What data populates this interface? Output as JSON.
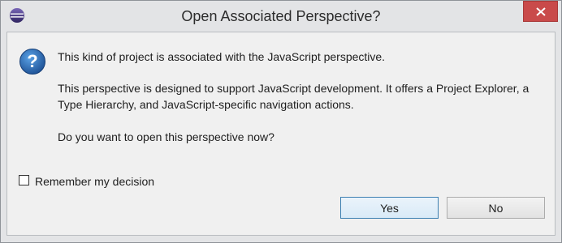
{
  "window": {
    "title": "Open Associated Perspective?",
    "app_icon": "eclipse-icon",
    "close_icon": "close-icon"
  },
  "dialog": {
    "icon": "question-icon",
    "message_line1": "This kind of project is associated with the JavaScript perspective.",
    "message_line2": "This perspective is designed to support JavaScript development. It offers a Project Explorer, a Type Hierarchy, and JavaScript-specific navigation actions.",
    "message_line3": "Do you want to open this perspective now?",
    "remember_label": "Remember my decision",
    "remember_checked": false
  },
  "buttons": {
    "yes_label": "Yes",
    "no_label": "No"
  },
  "colors": {
    "close_button": "#c94a4a",
    "question_icon": "#1f5fa8",
    "default_button_border": "#3c7fb1"
  }
}
